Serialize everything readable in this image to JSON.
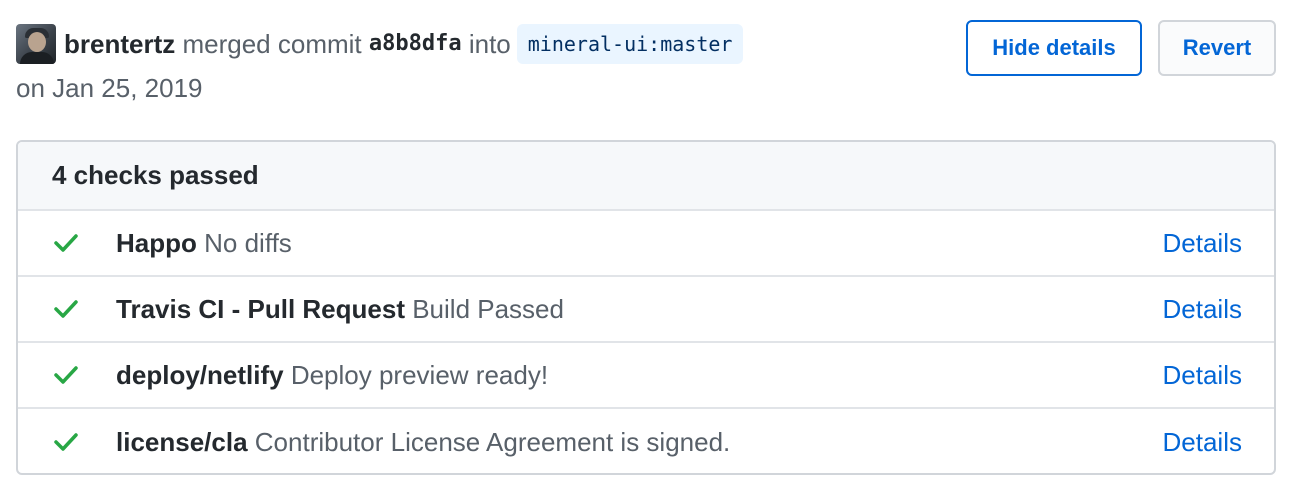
{
  "merge_info": {
    "author": "brentertz",
    "merged_text": "merged commit",
    "commit_sha": "a8b8dfa",
    "into_text": "into",
    "target_branch": "mineral-ui:master",
    "date_text": "on Jan 25, 2019"
  },
  "actions": {
    "hide_details_label": "Hide details",
    "revert_label": "Revert"
  },
  "checks": {
    "summary": "4 checks passed",
    "items": [
      {
        "name": "Happo",
        "description": "No diffs",
        "status": "success",
        "link_label": "Details"
      },
      {
        "name": "Travis CI - Pull Request",
        "description": "Build Passed",
        "status": "success",
        "link_label": "Details"
      },
      {
        "name": "deploy/netlify",
        "description": "Deploy preview ready!",
        "status": "success",
        "link_label": "Details"
      },
      {
        "name": "license/cla",
        "description": "Contributor License Agreement is signed.",
        "status": "success",
        "link_label": "Details"
      }
    ]
  },
  "icons": {
    "status_success": "check-icon"
  },
  "colors": {
    "link": "#0366d6",
    "success": "#28a745",
    "branch_bg": "#eaf5ff",
    "branch_text": "#032f62"
  }
}
